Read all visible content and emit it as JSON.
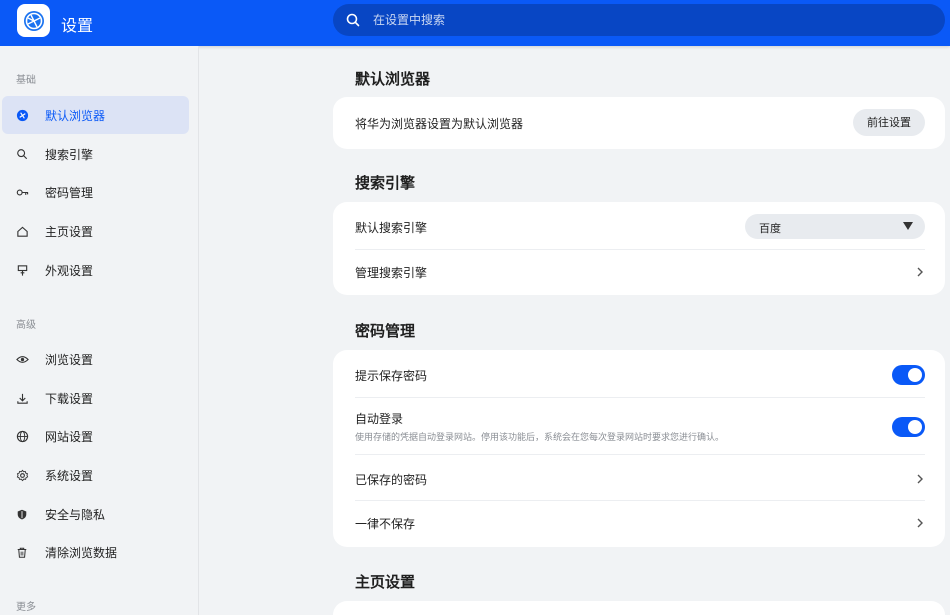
{
  "header": {
    "title": "设置",
    "search_placeholder": "在设置中搜索"
  },
  "sidebar": {
    "groups": [
      "基础",
      "高级",
      "更多"
    ],
    "items": [
      {
        "label": "默认浏览器",
        "icon": "globe-icon",
        "active": true
      },
      {
        "label": "搜索引擎",
        "icon": "search-icon",
        "active": false
      },
      {
        "label": "密码管理",
        "icon": "key-icon",
        "active": false
      },
      {
        "label": "主页设置",
        "icon": "home-icon",
        "active": false
      },
      {
        "label": "外观设置",
        "icon": "brush-icon",
        "active": false
      },
      {
        "label": "浏览设置",
        "icon": "eye-icon",
        "active": false
      },
      {
        "label": "下载设置",
        "icon": "download-icon",
        "active": false
      },
      {
        "label": "网站设置",
        "icon": "globe-grid-icon",
        "active": false
      },
      {
        "label": "系统设置",
        "icon": "gear-icon",
        "active": false
      },
      {
        "label": "安全与隐私",
        "icon": "shield-icon",
        "active": false
      },
      {
        "label": "清除浏览数据",
        "icon": "trash-icon",
        "active": false
      }
    ]
  },
  "main": {
    "default_browser": {
      "title": "默认浏览器",
      "row_label": "将华为浏览器设置为默认浏览器",
      "button": "前往设置"
    },
    "search_engine": {
      "title": "搜索引擎",
      "default_label": "默认搜索引擎",
      "default_value": "百度",
      "manage_label": "管理搜索引擎"
    },
    "password": {
      "title": "密码管理",
      "prompt_save_label": "提示保存密码",
      "prompt_save_on": true,
      "auto_login_label": "自动登录",
      "auto_login_desc": "使用存储的凭据自动登录网站。停用该功能后，系统会在您每次登录网站时要求您进行确认。",
      "auto_login_on": true,
      "saved_label": "已保存的密码",
      "never_label": "一律不保存"
    },
    "homepage": {
      "title": "主页设置"
    }
  },
  "colors": {
    "brand": "#0a59f7",
    "active_bg": "#dce3f5",
    "page_bg": "#f1f3f5"
  }
}
